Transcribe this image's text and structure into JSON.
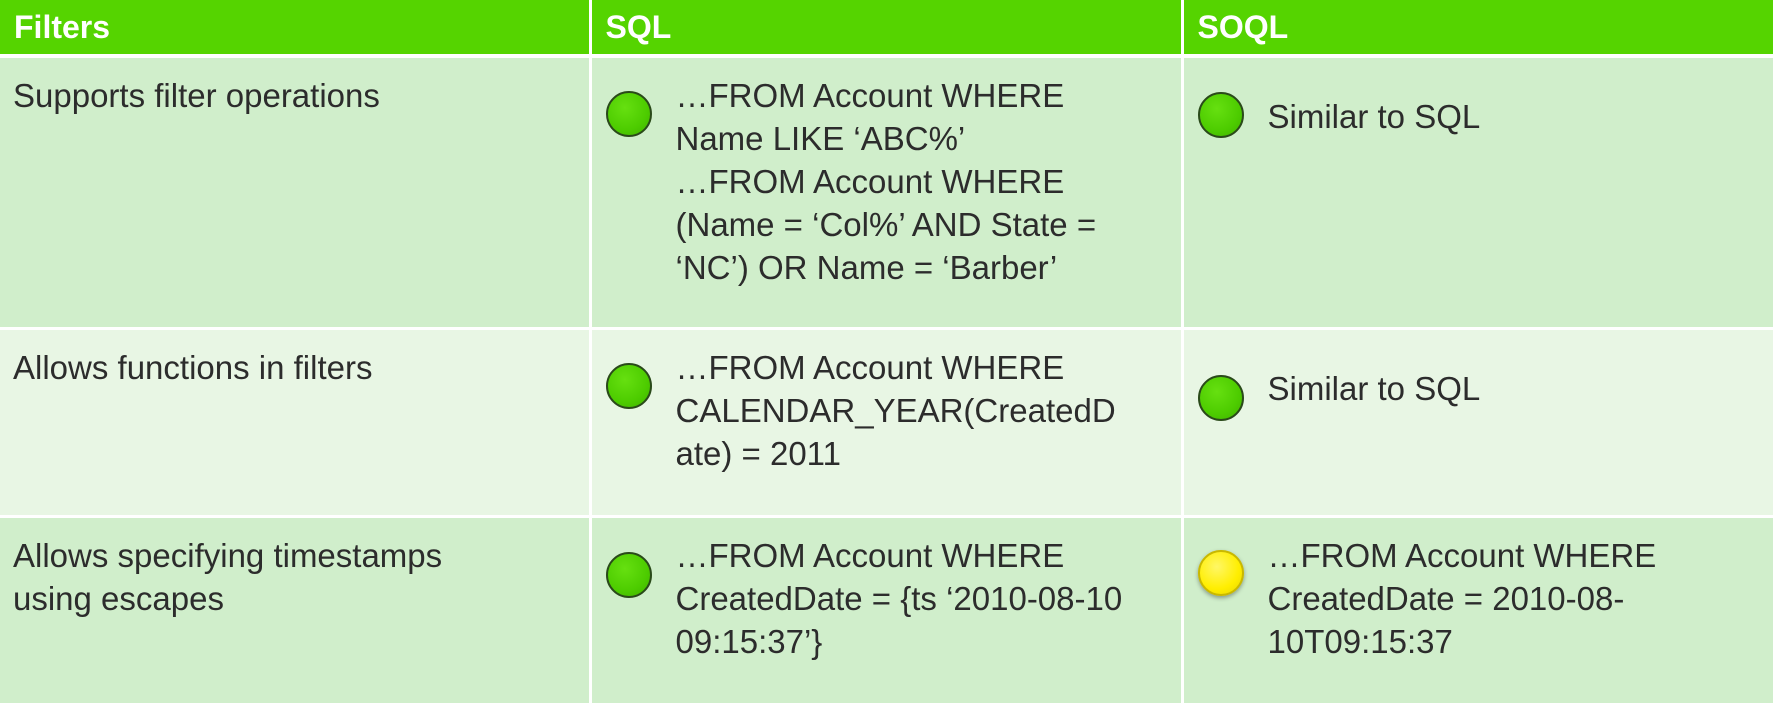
{
  "header": {
    "col1": "Filters",
    "col2": "SQL",
    "col3": "SOQL"
  },
  "rows": [
    {
      "feature": "Supports filter operations",
      "sql_status": "green",
      "sql_lines": [
        "…FROM Account WHERE",
        "Name LIKE ‘ABC%’",
        "…FROM Account WHERE",
        "(Name = ‘Col%’ AND State =",
        "‘NC’) OR Name = ‘Barber’"
      ],
      "soql_status": "green",
      "soql_lines": [
        "Similar to SQL"
      ]
    },
    {
      "feature": "Allows functions in filters",
      "sql_status": "green",
      "sql_lines": [
        "…FROM Account WHERE",
        "CALENDAR_YEAR(CreatedD",
        "ate) = 2011"
      ],
      "soql_status": "green",
      "soql_lines": [
        "Similar to SQL"
      ]
    },
    {
      "feature_lines": [
        "Allows specifying timestamps",
        "using escapes"
      ],
      "sql_status": "green",
      "sql_lines": [
        "…FROM Account WHERE",
        "CreatedDate = {ts ‘2010-08-10",
        "09:15:37’}"
      ],
      "soql_status": "yellow",
      "soql_lines": [
        "…FROM Account WHERE",
        "CreatedDate = 2010-08-",
        "10T09:15:37"
      ]
    }
  ],
  "status_colors": {
    "green": "#4dcc00",
    "yellow": "#ffee00"
  }
}
